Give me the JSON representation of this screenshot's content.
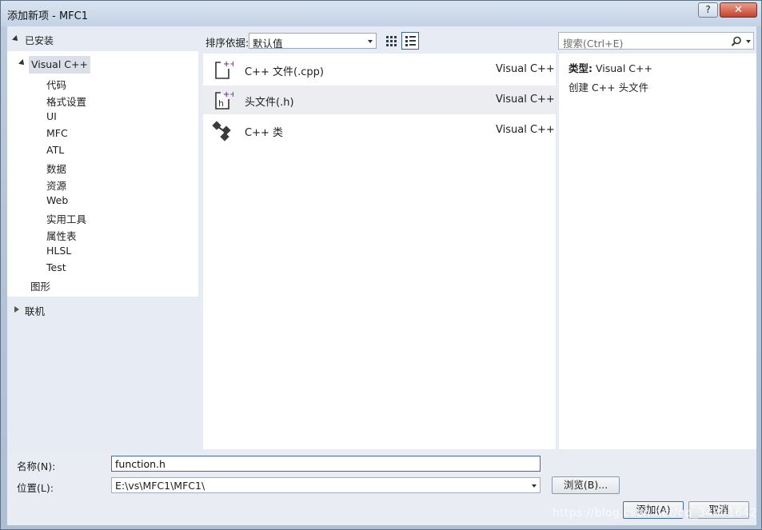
{
  "window": {
    "title": "添加新项 - MFC1",
    "help_label": "?",
    "close_label": "✕"
  },
  "left": {
    "installed_label": "已安装",
    "root": "Visual C++",
    "children": [
      "代码",
      "格式设置",
      "UI",
      "MFC",
      "ATL",
      "数据",
      "资源",
      "Web",
      "实用工具",
      "属性表",
      "HLSL",
      "Test"
    ],
    "other": "图形",
    "online_label": "联机"
  },
  "toolbar": {
    "sort_label": "排序依据:",
    "sort_value": "默认值",
    "search_placeholder": "搜索(Ctrl+E)"
  },
  "templates": [
    {
      "name": "C++ 文件(.cpp)",
      "lang": "Visual C++",
      "icon": "cpp-file-icon"
    },
    {
      "name": "头文件(.h)",
      "lang": "Visual C++",
      "icon": "header-file-icon"
    },
    {
      "name": "C++ 类",
      "lang": "Visual C++",
      "icon": "cpp-class-icon"
    }
  ],
  "description": {
    "type_label": "类型:",
    "type_value": "Visual C++",
    "text": "创建 C++ 头文件"
  },
  "form": {
    "name_label": "名称(N):",
    "name_value": "function.h",
    "location_label": "位置(L):",
    "location_value": "E:\\vs\\MFC1\\MFC1\\",
    "browse_label": "浏览(B)...",
    "add_label": "添加(A)",
    "cancel_label": "取消"
  },
  "watermark": "https://blog.csdn.net/qq_34801642"
}
